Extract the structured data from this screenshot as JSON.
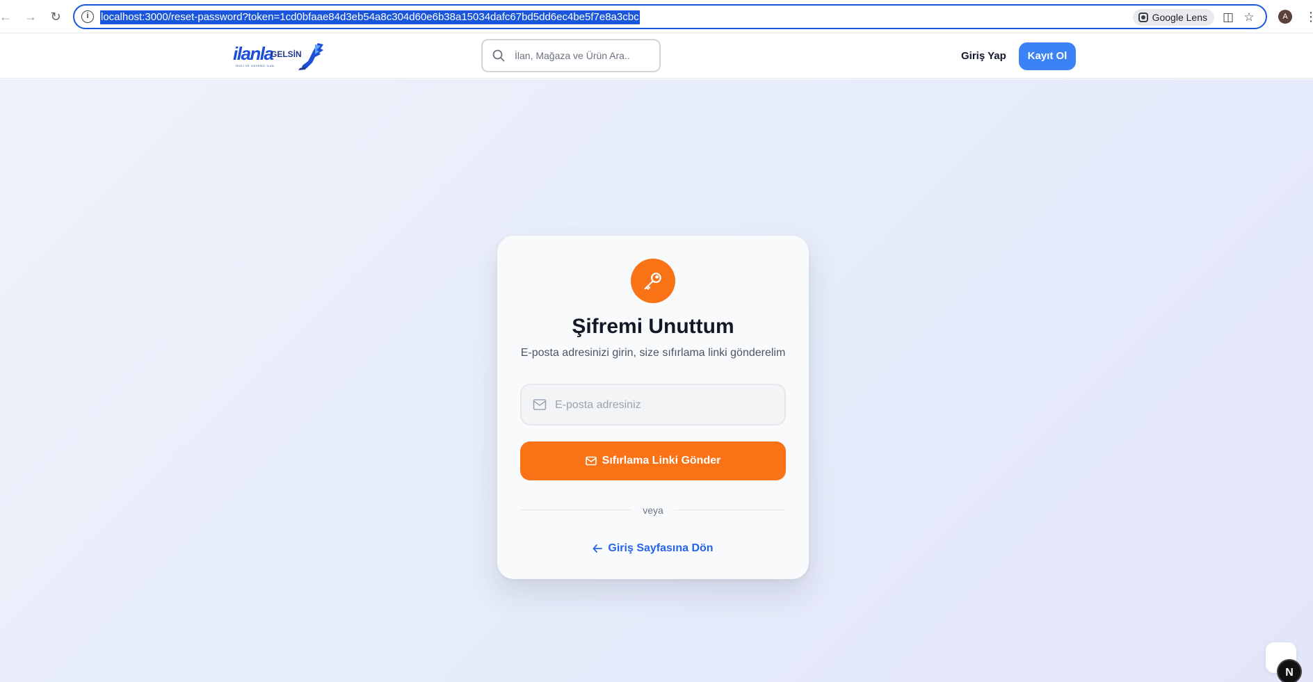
{
  "browser": {
    "url": "localhost:3000/reset-password?token=1cd0bfaae84d3eb54a8c304d60e6b38a15034dafc67bd5dd6ec4be5f7e8a3cbc",
    "lens_label": "Google Lens",
    "profile_initial": "A"
  },
  "header": {
    "logo_primary": "ilanla",
    "logo_secondary": "GELSİN",
    "logo_tagline": "HIZLI VE GÜVENLİ İLAN",
    "search_placeholder": "İlan, Mağaza ve Ürün Ara..",
    "login_label": "Giriş Yap",
    "signup_label": "Kayıt Ol"
  },
  "card": {
    "title": "Şifremi Unuttum",
    "subtitle": "E-posta adresinizi girin, size sıfırlama linki gönderelim",
    "email_placeholder": "E-posta adresiniz",
    "email_value": "",
    "submit_label": "Sıfırlama Linki Gönder",
    "divider_text": "veya",
    "back_label": "Giriş Sayfasına Dön"
  },
  "colors": {
    "accent": "#f97316",
    "primary": "#3b82f6",
    "link": "#2563eb"
  },
  "dev_badge": {
    "label": "N"
  }
}
